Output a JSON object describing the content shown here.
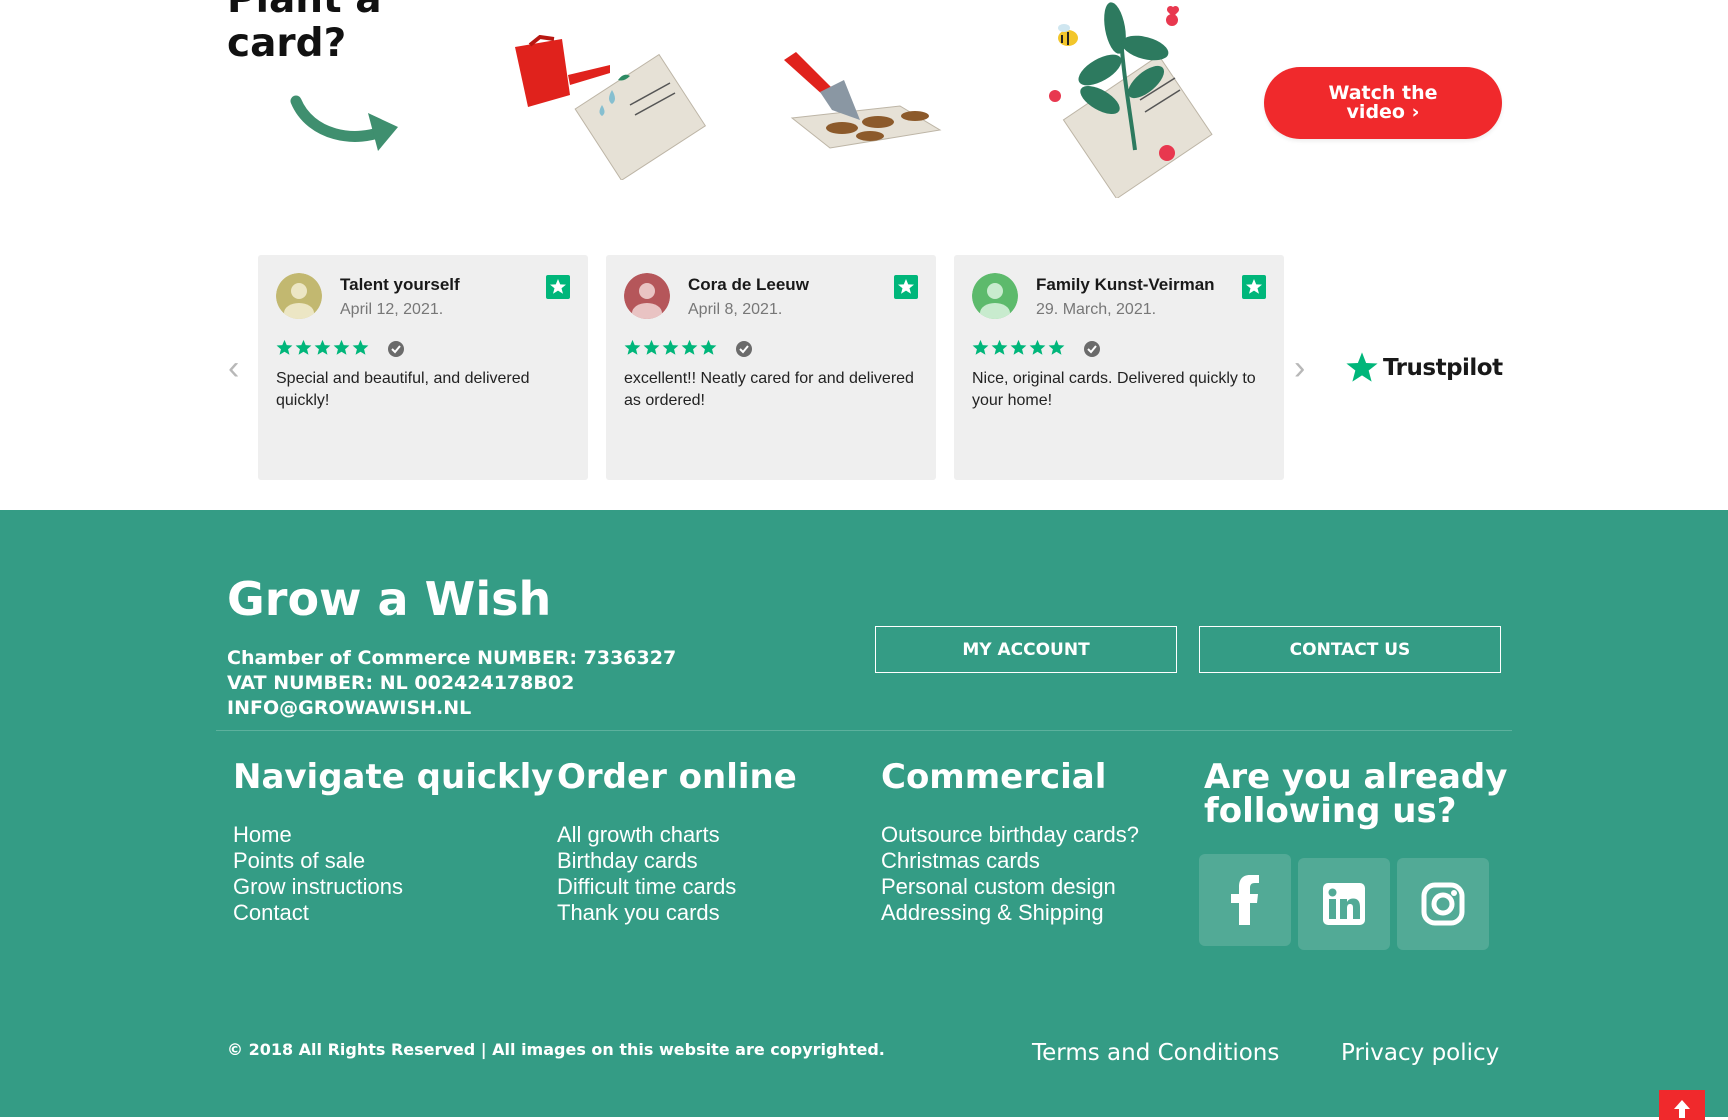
{
  "hero": {
    "title_line1": "Plant a",
    "title_line2": "card?",
    "watch_line1": "Watch the",
    "watch_line2": "video ›"
  },
  "reviews": [
    {
      "name": "Talent yourself",
      "date": "April 12, 2021.",
      "rating": 5,
      "text": "Special and beautiful, and delivered quickly!",
      "avatar_color": "#c2b870"
    },
    {
      "name": "Cora de Leeuw",
      "date": "April 8, 2021.",
      "rating": 5,
      "text": "excellent!! Neatly cared for and delivered as ordered!",
      "avatar_color": "#b5565a"
    },
    {
      "name": "Family Kunst-Veirman",
      "date": "29. March, 2021.",
      "rating": 5,
      "text": "Nice, original cards. Delivered quickly to your home!",
      "avatar_color": "#5dba6c"
    }
  ],
  "trustpilot": {
    "label": "Trustpilot"
  },
  "footer": {
    "brand": "Grow a Wish",
    "chamber": "Chamber of Commerce NUMBER: 7336327",
    "vat": "VAT NUMBER: NL 002424178B02",
    "email": "INFO@GROWAWISH.NL",
    "my_account": "MY ACCOUNT",
    "contact_us": "CONTACT US",
    "columns": [
      {
        "title": "Navigate quickly",
        "links": [
          "Home",
          "Points of sale",
          "Grow instructions",
          "Contact"
        ]
      },
      {
        "title": "Order online",
        "links": [
          "All growth charts",
          "Birthday cards",
          "Difficult time cards",
          "Thank you cards"
        ]
      },
      {
        "title": "Commercial",
        "links": [
          "Outsource birthday cards?",
          "Christmas cards",
          "Personal custom design",
          "Addressing & Shipping"
        ]
      }
    ],
    "follow_line1": "Are you already",
    "follow_line2": "following us?",
    "social_icons": [
      "facebook-icon",
      "linkedin-icon",
      "instagram-icon"
    ],
    "copyright": "© 2018 All Rights Reserved | All images on this website are copyrighted.",
    "terms": "Terms and Conditions",
    "privacy": "Privacy policy"
  },
  "colors": {
    "accent_red": "#f0292c",
    "footer_green": "#349c85",
    "trustpilot_green": "#00b67a"
  }
}
